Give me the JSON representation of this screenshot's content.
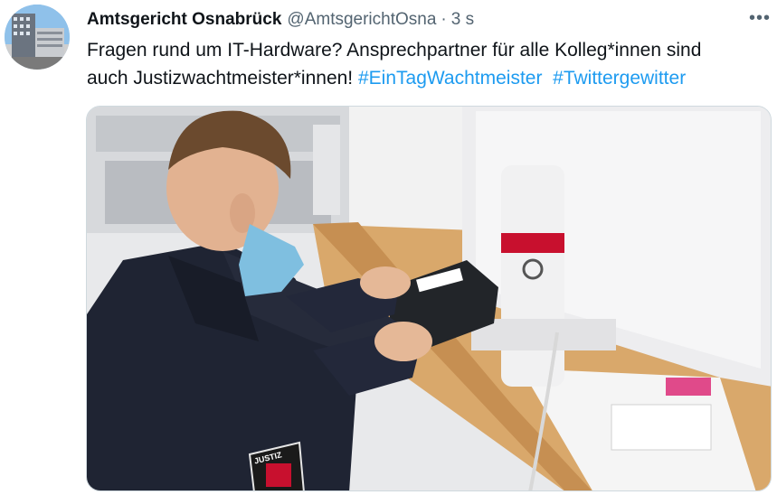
{
  "tweet": {
    "display_name": "Amtsgericht Osnabrück",
    "handle": "@AmtsgerichtOsna",
    "separator": "·",
    "time": "3 s",
    "more_label": "•••",
    "text_line1": "Fragen rund um IT-Hardware? Ansprechpartner für alle Kolleg*innen sind",
    "text_line2_prefix": "auch Justizwachtmeister*innen!",
    "hashtags": [
      "#EinTagWachtmeister",
      "#Twittergewitter"
    ],
    "media_badge_text": "JUSTIZ"
  },
  "colors": {
    "link": "#1d9bf0",
    "secondary_text": "#536471",
    "primary_text": "#0f1419",
    "uniform": "#1f2433",
    "monitor": "#e9e9eb",
    "desk": "#d9a86b",
    "accent_red": "#c8102e"
  }
}
